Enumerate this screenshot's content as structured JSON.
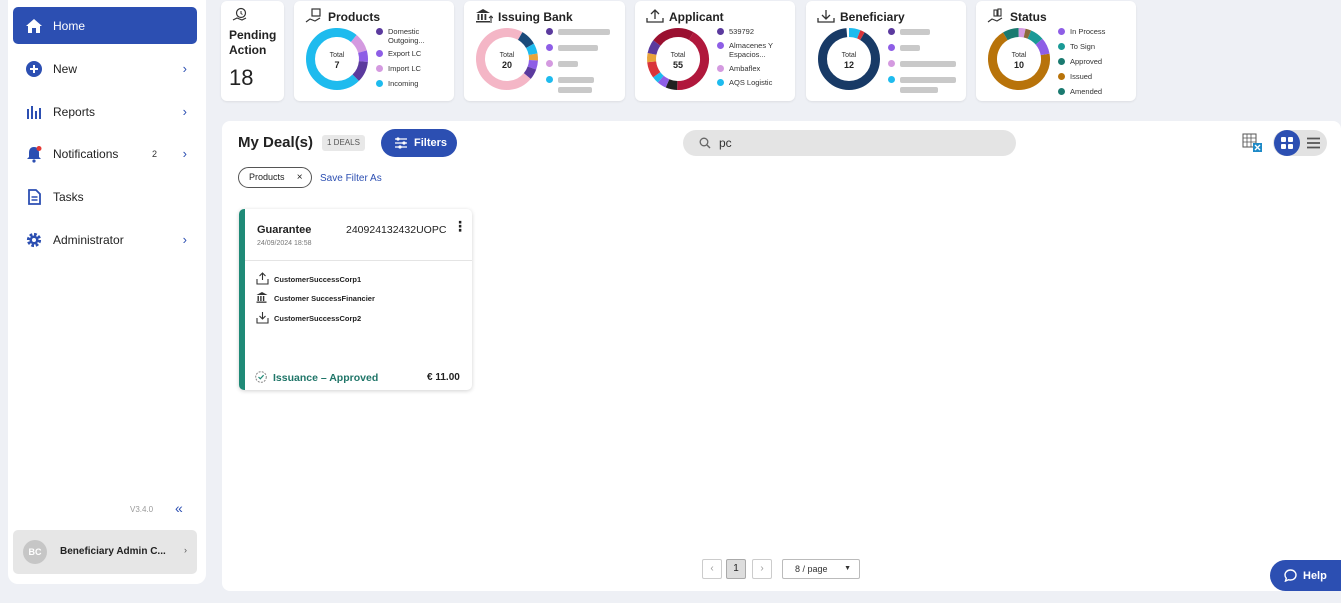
{
  "sidebar": {
    "items": [
      {
        "label": "Home",
        "icon": "home-icon",
        "active": true
      },
      {
        "label": "New",
        "icon": "plus-circle-icon"
      },
      {
        "label": "Reports",
        "icon": "bar-chart-icon"
      },
      {
        "label": "Notifications",
        "icon": "bell-icon",
        "badge": "2"
      },
      {
        "label": "Tasks",
        "icon": "document-icon"
      },
      {
        "label": "Administrator",
        "icon": "gear-icon"
      }
    ],
    "version": "V3.4.0",
    "collapse_glyph": "«",
    "chevron": "›",
    "user": {
      "initials": "BC",
      "name": "Beneficiary Admin C..."
    }
  },
  "pending": {
    "label_line1": "Pending",
    "label_line2": "Action",
    "count": "18"
  },
  "dashboard": {
    "total_label": "Total",
    "products": {
      "title": "Products",
      "total": "7",
      "legend": [
        {
          "label": "Domestic Outgoing...",
          "color": "#5b3a9e"
        },
        {
          "label": "Export LC",
          "color": "#8e5ee6"
        },
        {
          "label": "Import LC",
          "color": "#d49ae0"
        },
        {
          "label": "Incoming",
          "color": "#1ebbee"
        }
      ]
    },
    "issuing_bank": {
      "title": "Issuing Bank",
      "total": "20",
      "legend_colors": [
        "#5b3a9e",
        "#8e5ee6",
        "#d49ae0",
        "#1ebbee"
      ]
    },
    "applicant": {
      "title": "Applicant",
      "total": "55",
      "legend": [
        {
          "label": "539792",
          "color": "#5b3a9e"
        },
        {
          "label": "Almacenes Y Espacios...",
          "color": "#8e5ee6"
        },
        {
          "label": "Ambaflex",
          "color": "#d49ae0"
        },
        {
          "label": "AQS Logistic",
          "color": "#1ebbee"
        }
      ]
    },
    "beneficiary": {
      "title": "Beneficiary",
      "total": "12",
      "legend_colors": [
        "#5b3a9e",
        "#8e5ee6",
        "#d49ae0",
        "#1ebbee"
      ]
    },
    "status": {
      "title": "Status",
      "total": "10",
      "legend": [
        {
          "label": "In Process",
          "color": "#8e5ee6"
        },
        {
          "label": "To Sign",
          "color": "#1a9a96"
        },
        {
          "label": "Approved",
          "color": "#1a7a70"
        },
        {
          "label": "Issued",
          "color": "#b8730a"
        },
        {
          "label": "Amended",
          "color": "#1a7a70"
        }
      ]
    }
  },
  "main": {
    "title": "My Deal(s)",
    "deals_badge": "1 DEALS",
    "filters_label": "Filters",
    "search_value": "pc",
    "chip_label": "Products",
    "chip_close": "×",
    "save_filter_label": "Save Filter As"
  },
  "deal": {
    "type": "Guarantee",
    "id": "240924132432UOPC",
    "date": "24/09/2024 18:58",
    "menu_glyph": "⋮",
    "applicant": "CustomerSuccessCorp1",
    "issuing_bank": "Customer SuccessFinancier",
    "beneficiary": "CustomerSuccessCorp2",
    "status": "Issuance – Approved",
    "amount": "€ 11.00"
  },
  "pagination": {
    "prev": "‹",
    "page": "1",
    "next": "›",
    "per_page": "8 / page",
    "caret": "▼"
  },
  "help_label": "Help",
  "colors": {
    "accent": "#2c4fb2",
    "status_green": "#1f8a77"
  }
}
